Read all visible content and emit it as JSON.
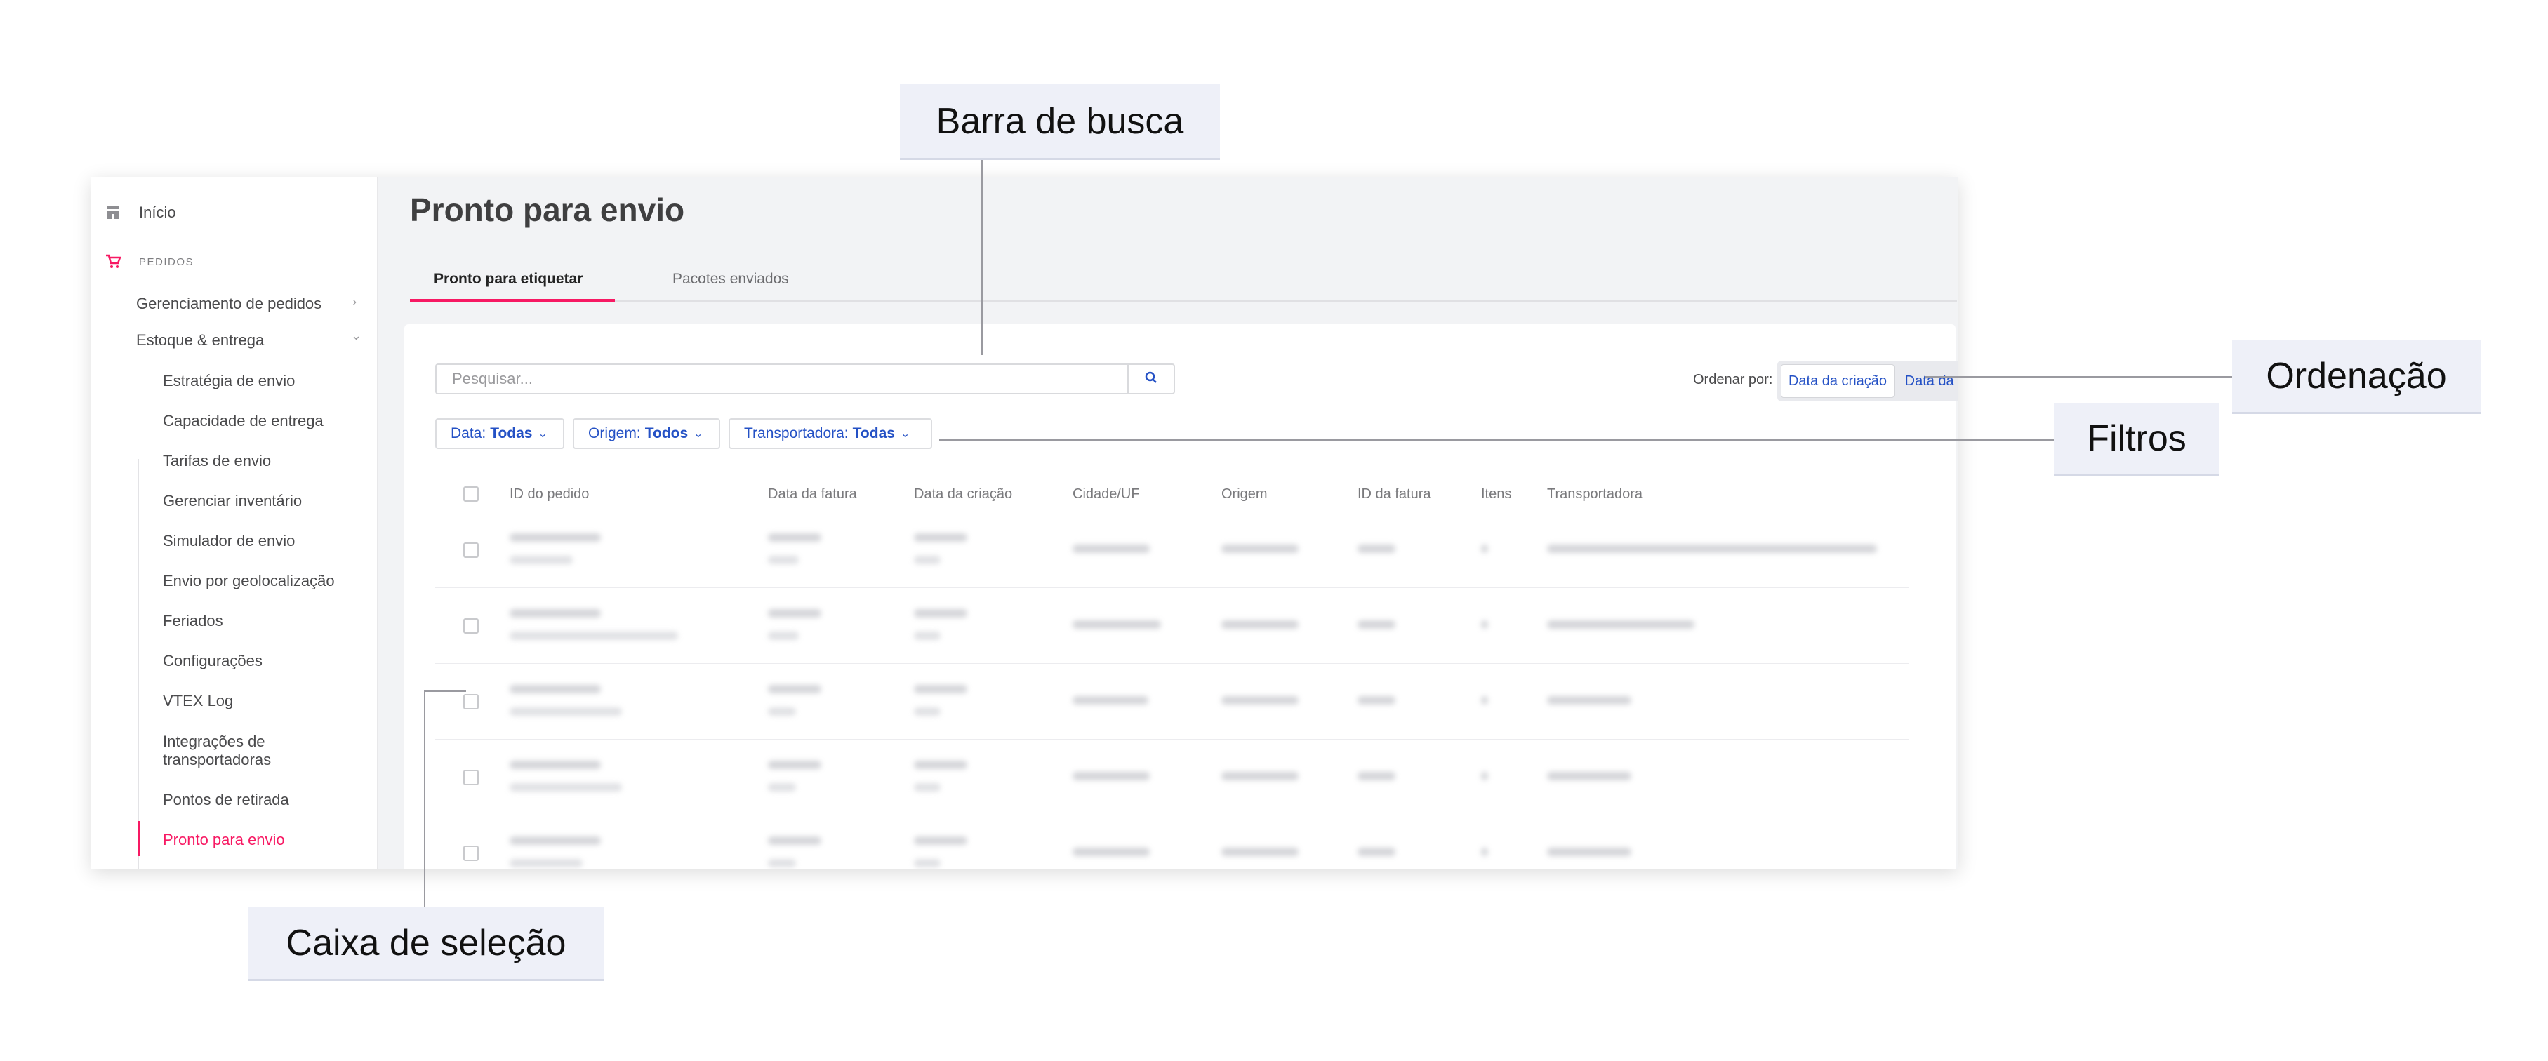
{
  "sidebar": {
    "home_label": "Início",
    "section_label": "PEDIDOS",
    "groups": [
      {
        "label": "Gerenciamento de pedidos"
      },
      {
        "label": "Estoque & entrega"
      }
    ],
    "items": [
      {
        "label": "Estratégia de envio"
      },
      {
        "label": "Capacidade de entrega"
      },
      {
        "label": "Tarifas de envio"
      },
      {
        "label": "Gerenciar inventário"
      },
      {
        "label": "Simulador de envio"
      },
      {
        "label": "Envio por geolocalização"
      },
      {
        "label": "Feriados"
      },
      {
        "label": "Configurações"
      },
      {
        "label": "VTEX Log"
      },
      {
        "label": "Integrações de transportadoras"
      },
      {
        "label": "Pontos de retirada"
      },
      {
        "label": "Pronto para envio"
      }
    ]
  },
  "main": {
    "title": "Pronto para envio",
    "tabs": [
      {
        "label": "Pronto para etiquetar"
      },
      {
        "label": "Pacotes enviados"
      }
    ],
    "search": {
      "placeholder": "Pesquisar..."
    },
    "sort": {
      "label": "Ordenar por:",
      "options": [
        {
          "label": "Data da criação"
        },
        {
          "label": "Data da fatura"
        }
      ]
    },
    "filters": [
      {
        "name": "Data:",
        "value": "Todas"
      },
      {
        "name": "Origem:",
        "value": "Todos"
      },
      {
        "name": "Transportadora:",
        "value": "Todas"
      }
    ],
    "table": {
      "columns": [
        "ID do pedido",
        "Data da fatura",
        "Data da criação",
        "Cidade/UF",
        "Origem",
        "ID da fatura",
        "Itens",
        "Transportadora"
      ]
    }
  },
  "annotations": {
    "search_bar": "Barra de busca",
    "sorting": "Ordenação",
    "filters": "Filtros",
    "checkbox": "Caixa de seleção"
  },
  "colors": {
    "accent": "#f71963",
    "link": "#2451c5",
    "callout_bg": "#eef0f8"
  }
}
